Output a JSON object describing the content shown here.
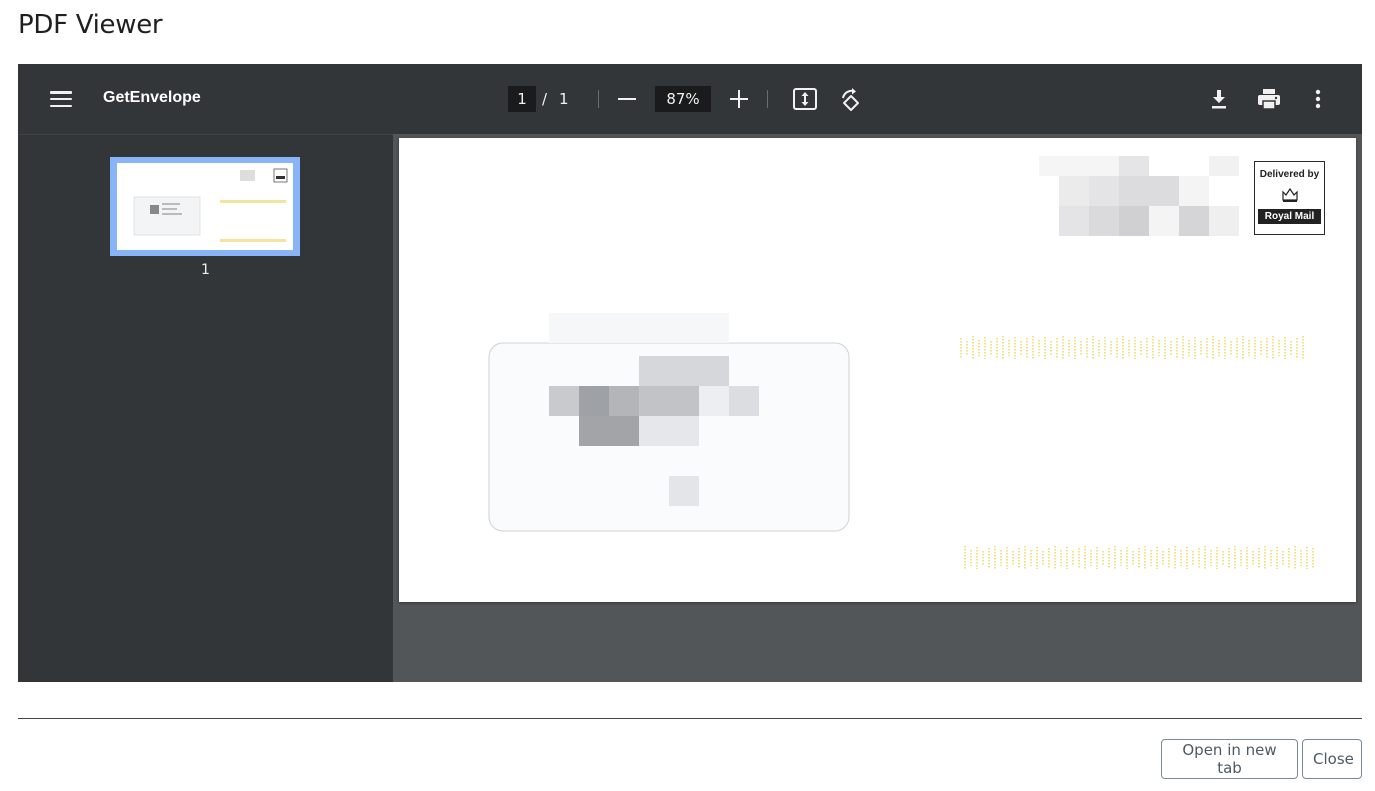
{
  "dialog": {
    "title": "PDF Viewer",
    "buttons": {
      "open_new_tab": "Open in new tab",
      "close": "Close"
    }
  },
  "viewer": {
    "document_title": "GetEnvelope",
    "page": {
      "current": "1",
      "separator": "/",
      "total": "1"
    },
    "zoom": "87%",
    "thumbnails": [
      {
        "label": "1",
        "selected": true
      }
    ],
    "icons": {
      "menu": "menu-icon",
      "zoom_out": "minus-icon",
      "zoom_in": "plus-icon",
      "fit": "fit-to-page-icon",
      "rotate": "rotate-icon",
      "download": "download-icon",
      "print": "print-icon",
      "more": "more-vert-icon"
    }
  },
  "envelope": {
    "badge_top": "Delivered by",
    "badge_bottom": "Royal Mail"
  },
  "colors": {
    "toolbar": "#323639",
    "viewer_bg": "#525659",
    "thumb_selected": "#8ab4f8",
    "barcode": "#f2d84b"
  }
}
